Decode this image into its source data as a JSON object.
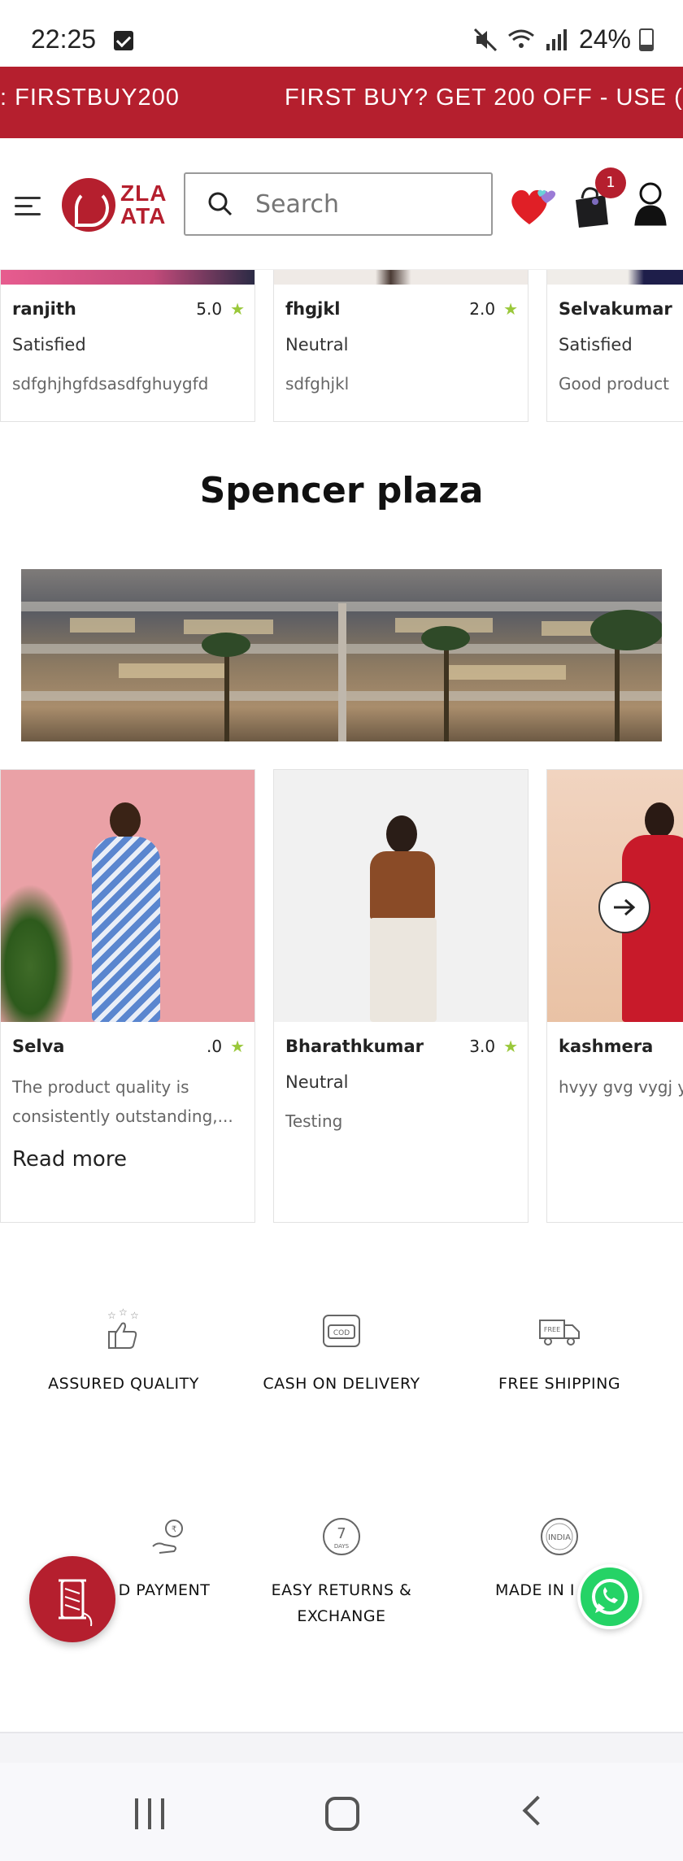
{
  "status_bar": {
    "time": "22:25",
    "battery": "24%"
  },
  "promo": {
    "text_left": ": FIRSTBUY200",
    "text_right": "FIRST BUY? GET 200 OFF - USE ("
  },
  "header": {
    "logo_top": "ZLA",
    "logo_bottom": "ATA",
    "search_placeholder": "Search",
    "cart_count": "1"
  },
  "reviews_top": [
    {
      "name": "ranjith",
      "rating": "5.0",
      "sentiment": "Satisfied",
      "comment": "sdfghjhgfdsasdfghuygfd"
    },
    {
      "name": "fhgjkl",
      "rating": "2.0",
      "sentiment": "Neutral",
      "comment": "sdfghjkl"
    },
    {
      "name": "Selvakumar",
      "rating": "",
      "sentiment": "Satisfied",
      "comment": "Good product"
    }
  ],
  "section": {
    "title": "Spencer plaza"
  },
  "reviews_products": [
    {
      "name": "Selva",
      "rating": ".0",
      "sentiment": "",
      "comment": "The product quality is consistently outstanding,...",
      "read_more": "Read more"
    },
    {
      "name": "Bharathkumar",
      "rating": "3.0",
      "sentiment": "Neutral",
      "comment": "Testing"
    },
    {
      "name": "kashmera",
      "rating": "",
      "sentiment": "",
      "comment": "hvyy gvg vygj y"
    }
  ],
  "features": [
    {
      "label": "ASSURED QUALITY",
      "icon": "thumbs-up-stars-icon"
    },
    {
      "label": "CASH ON DELIVERY",
      "icon": "cod-icon"
    },
    {
      "label": "FREE SHIPPING",
      "icon": "free-truck-icon"
    },
    {
      "label": "D PAYMENT",
      "icon": "secure-payment-icon"
    },
    {
      "label": "EASY RETURNS &",
      "label2": "EXCHANGE",
      "icon": "7-days-icon"
    },
    {
      "label": "MADE IN I",
      "icon": "india-badge-icon"
    }
  ],
  "colors": {
    "brand_red": "#b51f2e",
    "star_green": "#9ac83a",
    "whatsapp_green": "#25d366"
  }
}
